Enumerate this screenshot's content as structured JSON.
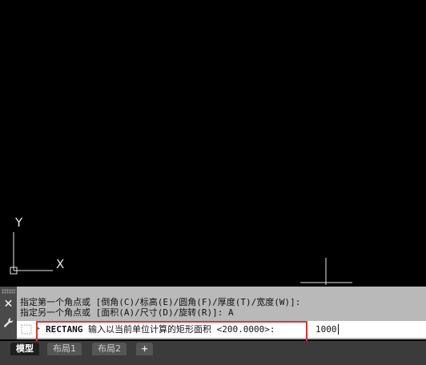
{
  "canvas": {
    "ucs_y_label": "Y",
    "ucs_x_label": "X",
    "background_color": "#000000"
  },
  "command_line": {
    "history": [
      "指定第一个角点或 [倒角(C)/标高(E)/圆角(F)/厚度(T)/宽度(W)]:",
      "指定另一个角点或 [面积(A)/尺寸(D)/旋转(R)]: A"
    ],
    "prompt_command": "RECTANG",
    "prompt_message": " 输入以当前单位计算的矩形面积 <200.0000>:",
    "input_value": "1000",
    "highlight_color": "#e03535",
    "close_icon": "close-icon",
    "customize_icon": "wrench-icon"
  },
  "layout_tabs": [
    {
      "label": "模型",
      "active": true
    },
    {
      "label": "布局1",
      "active": false
    },
    {
      "label": "布局2",
      "active": false
    },
    {
      "label": "+",
      "active": false
    }
  ]
}
